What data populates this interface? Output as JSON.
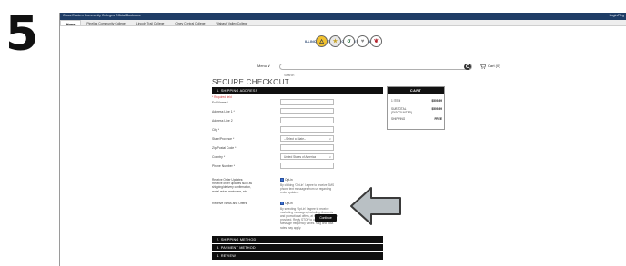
{
  "step_number": "5",
  "browser": {
    "top_strip_left": "Cross Eastern Community Colleges Official Bookstore",
    "top_strip_right": "Login/Reg",
    "tabs": [
      "Home",
      "Pinellas Community College",
      "Lincoln Trail College",
      "Olney Central College",
      "Wabash Valley College"
    ]
  },
  "brand": {
    "name": "ILLINOIS EASTERN COMMUNITY COLLEGES",
    "logo_glyphs": [
      "△",
      "★",
      "σ",
      "♥",
      "❦"
    ]
  },
  "nav": {
    "menu_label": "Menu",
    "menu_chevron": "∨",
    "search_placeholder": "Search",
    "cart_label": "Cart (0)"
  },
  "checkout": {
    "title": "SECURE CHECKOUT",
    "sections": [
      "1. SHIPPING ADDRESS",
      "2. SHIPPING METHOD",
      "3. PAYMENT METHOD",
      "4. REVIEW"
    ],
    "required_note": "* Required field",
    "fields": [
      {
        "label": "Full Name *",
        "value": ""
      },
      {
        "label": "Address Line 1 *",
        "value": ""
      },
      {
        "label": "Address Line 2",
        "value": ""
      },
      {
        "label": "City *",
        "value": ""
      },
      {
        "label": "State/Province *",
        "value": "--Select a State--",
        "select": true
      },
      {
        "label": "Zip/Postal Code *",
        "value": ""
      },
      {
        "label": "Country *",
        "value": "United States of America",
        "select": true
      },
      {
        "label": "Phone Number *",
        "value": ""
      }
    ],
    "optins": [
      {
        "label": "Receive Order Updates: Receive order updates such as shipping/delivery confirmation, rental return reminders, etc.",
        "check_label": "Opt-in",
        "desc": "By clicking 'Opt-in' I agree to receive SMS phone text messages from us regarding order updates."
      },
      {
        "label": "Receive News and Offers",
        "check_label": "Opt-in",
        "desc": "By selecting 'Opt-in' I agree to receive marketing messages, including discounts and promotional offers, at the phone number provided. Reply STOP to unsubscribe. Message frequency varies. Msg and data rates may apply."
      }
    ],
    "continue_label": "Continue"
  },
  "cart": {
    "title": "CART",
    "rows": [
      {
        "label": "1 ITEM",
        "value": "$509.99"
      },
      {
        "label": "SUBTOTAL (DISCOUNTED)",
        "value": "$509.99"
      },
      {
        "label": "SHIPPING",
        "value": "FREE"
      }
    ]
  },
  "colors": {
    "arrow_fill": "#b9c0c4",
    "arrow_stroke": "#3a3a3a",
    "section_bar": "#0f0f0f",
    "top_strip": "#1f3d66"
  }
}
